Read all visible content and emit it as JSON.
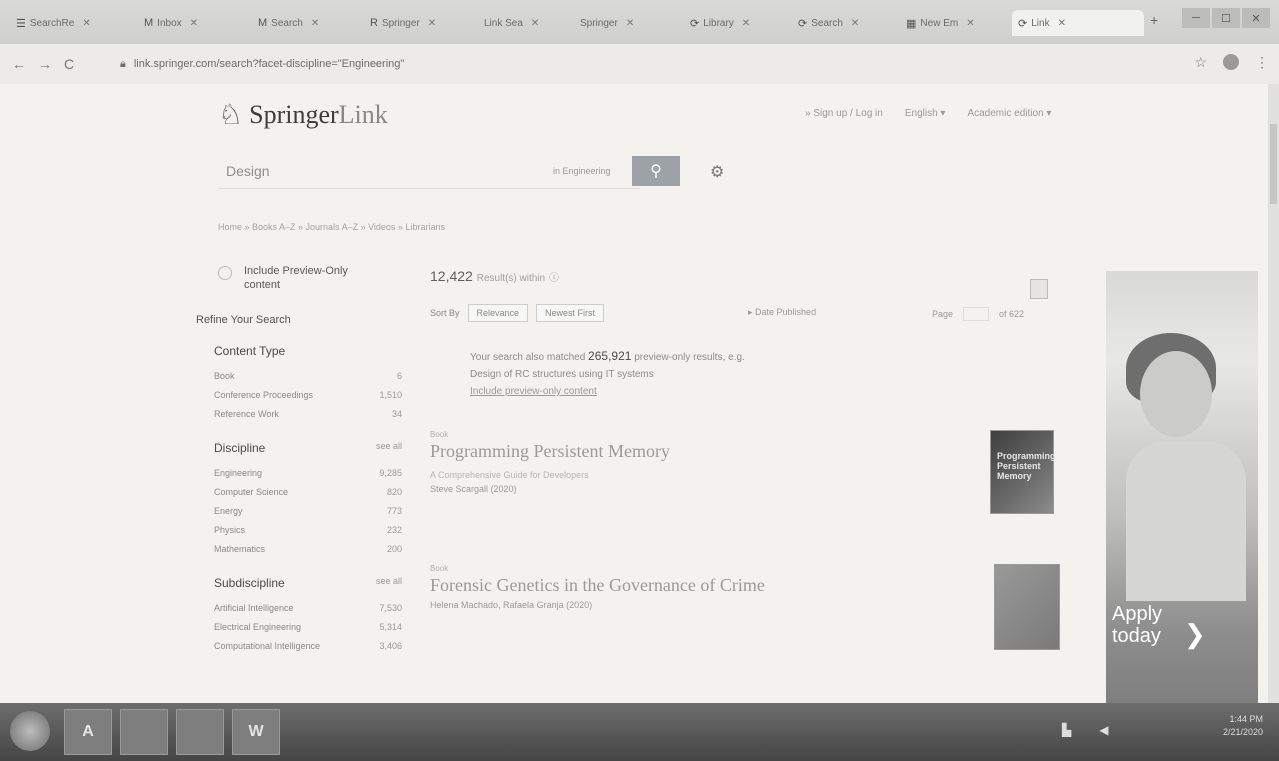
{
  "browser": {
    "tabs": [
      {
        "icon": "☰",
        "label": "SearchRe",
        "active": false
      },
      {
        "icon": "M",
        "label": "Inbox",
        "active": false
      },
      {
        "icon": "M",
        "label": "Search",
        "active": false
      },
      {
        "icon": "R",
        "label": "Springer",
        "active": false
      },
      {
        "icon": "",
        "label": "Link Sea",
        "active": false
      },
      {
        "icon": "",
        "label": "Springer",
        "active": false
      },
      {
        "icon": "⟳",
        "label": "Library",
        "active": false
      },
      {
        "icon": "⟳",
        "label": "Search",
        "active": false
      },
      {
        "icon": "▦",
        "label": "New Em",
        "active": false
      },
      {
        "icon": "⟳",
        "label": "Link",
        "active": true
      }
    ],
    "url_host": "link.springer.com",
    "url_path": "/search?facet-discipline=\"Engineering\""
  },
  "header": {
    "brand_springer": "Springer",
    "brand_link": "Link",
    "links": [
      "» Sign up / Log in",
      "English ▾",
      "Academic edition ▾"
    ]
  },
  "search": {
    "value": "Design",
    "within_label": "in Engineering",
    "button_icon": "search-icon"
  },
  "breadcrumbs": "Home  »  Books A–Z  »  Journals A–Z  »  Videos  »  Librarians",
  "sidebar": {
    "preview_label": "Include Preview-Only content",
    "refine_label": "Refine Your Search",
    "content_type_title": "Content Type",
    "content_type": [
      {
        "label": "Book",
        "count": "6"
      },
      {
        "label": "Conference Proceedings",
        "count": "1,510"
      },
      {
        "label": "Reference Work",
        "count": "34"
      }
    ],
    "discipline_title": "Discipline",
    "discipline_seeall": "see all",
    "discipline": [
      {
        "label": "Engineering",
        "count": "9,285"
      },
      {
        "label": "Computer Science",
        "count": "820"
      },
      {
        "label": "Energy",
        "count": "773"
      },
      {
        "label": "Physics",
        "count": "232"
      },
      {
        "label": "Mathematics",
        "count": "200"
      }
    ],
    "subdiscipline_title": "Subdiscipline",
    "subdiscipline_seeall": "see all",
    "subdiscipline": [
      {
        "label": "Artificial Intelligence",
        "count": "7,530"
      },
      {
        "label": "Electrical Engineering",
        "count": "5,314"
      },
      {
        "label": "Computational Intelligence",
        "count": "3,406"
      }
    ]
  },
  "results": {
    "count": "12,422",
    "count_suffix": "Result(s) within",
    "sort_by": "Sort By",
    "sort_options": [
      "Relevance",
      "Newest First"
    ],
    "date_published": "Date Published",
    "page_label": "Page",
    "page_total": "of 622",
    "preview_note_1": "Your search also matched",
    "preview_count": "265,921",
    "preview_note_2": "preview-only results, e.g.",
    "preview_example": "Design of RC structures using IT systems",
    "preview_link": "Include preview-only content",
    "items": [
      {
        "type": "Book",
        "title": "Programming Persistent Memory",
        "subtitle": "A Comprehensive Guide for Developers",
        "meta": "Steve Scargall (2020)",
        "cover_text": "Programming Persistent Memory"
      },
      {
        "type": "Book",
        "title": "Forensic Genetics in the Governance of Crime",
        "subtitle": "",
        "meta": "Helena Machado, Rafaela Granja (2020)",
        "cover_text": ""
      }
    ]
  },
  "ad": {
    "text_line1": "Apply",
    "text_line2": "today"
  },
  "taskbar": {
    "apps": [
      "A",
      "",
      "",
      "W"
    ],
    "time": "1:44 PM",
    "date": "2/21/2020"
  }
}
